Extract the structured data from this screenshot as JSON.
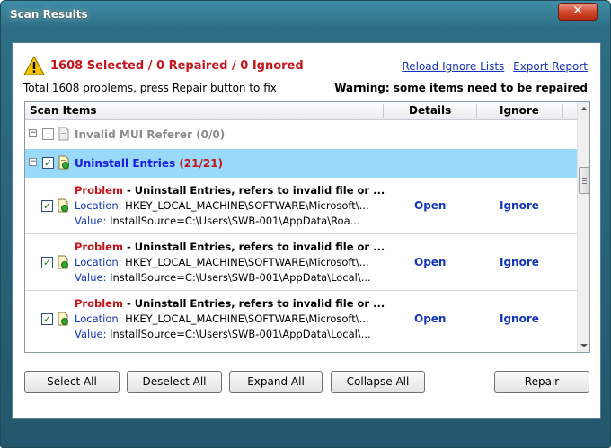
{
  "window": {
    "title": "Scan Results",
    "close_glyph": "✕"
  },
  "summary": {
    "title": "1608 Selected / 0 Repaired / 0 Ignored",
    "subtitle": "Total 1608 problems, press Repair button to fix",
    "warning": "Warning: some items need to be repaired",
    "links": [
      "Reload Ignore Lists",
      "Export Report"
    ],
    "icon": "warning-icon"
  },
  "columns": {
    "scan_items": "Scan Items",
    "details": "Details",
    "ignore": "Ignore"
  },
  "groups": [
    {
      "label": "Invalid MUI Referer",
      "count": "(0/0)",
      "checked": false,
      "expanded": true,
      "selected": false
    },
    {
      "label": "Uninstall Entries",
      "count": "(21/21)",
      "checked": true,
      "expanded": true,
      "selected": true
    }
  ],
  "items": [
    {
      "problem_label": "Problem",
      "problem_text": " - Uninstall Entries, refers to invalid file or ...",
      "location_label": "Location:",
      "location": " HKEY_LOCAL_MACHINE\\SOFTWARE\\Microsoft\\...",
      "value_label": "Value:",
      "value": " InstallSource=C:\\Users\\SWB-001\\AppData\\Roa...",
      "open": "Open",
      "ignore": "Ignore",
      "checked": true
    },
    {
      "problem_label": "Problem",
      "problem_text": " - Uninstall Entries, refers to invalid file or ...",
      "location_label": "Location:",
      "location": " HKEY_LOCAL_MACHINE\\SOFTWARE\\Microsoft\\...",
      "value_label": "Value:",
      "value": " InstallSource=C:\\Users\\SWB-001\\AppData\\Local\\...",
      "open": "Open",
      "ignore": "Ignore",
      "checked": true
    },
    {
      "problem_label": "Problem",
      "problem_text": " - Uninstall Entries, refers to invalid file or ...",
      "location_label": "Location:",
      "location": " HKEY_LOCAL_MACHINE\\SOFTWARE\\Microsoft\\...",
      "value_label": "Value:",
      "value": " InstallSource=C:\\Users\\SWB-001\\AppData\\Local\\...",
      "open": "Open",
      "ignore": "Ignore",
      "checked": true
    }
  ],
  "buttons": {
    "select_all": "Select All",
    "deselect_all": "Deselect All",
    "expand_all": "Expand All",
    "collapse_all": "Collapse All",
    "repair": "Repair"
  },
  "colors": {
    "accent_red": "#c4161c",
    "link_blue": "#1436b8",
    "selection": "#99d9f9",
    "titlebar": "#2e6f86"
  }
}
